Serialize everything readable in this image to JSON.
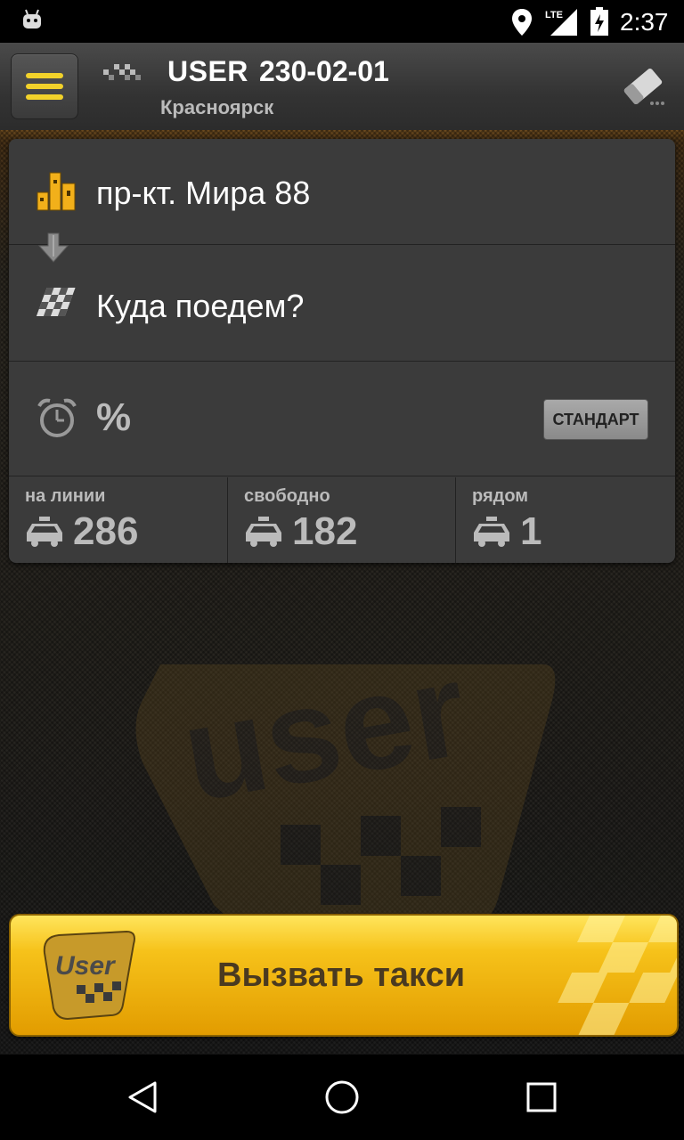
{
  "status_bar": {
    "time": "2:37",
    "network": "LTE"
  },
  "header": {
    "brand": "USER",
    "phone": "230-02-01",
    "city": "Красноярск"
  },
  "route": {
    "from": "пр-кт. Мира 88",
    "to_placeholder": "Куда поедем?",
    "discount": "%",
    "tariff": "СТАНДАРТ"
  },
  "stats": [
    {
      "label": "на линии",
      "value": "286"
    },
    {
      "label": "свободно",
      "value": "182"
    },
    {
      "label": "рядом",
      "value": "1"
    }
  ],
  "call_button": {
    "label": "Вызвать такси",
    "logo_text": "User"
  },
  "colors": {
    "accent": "#f2d22a",
    "button": "#f6c21a",
    "card": "#3b3b3b"
  }
}
